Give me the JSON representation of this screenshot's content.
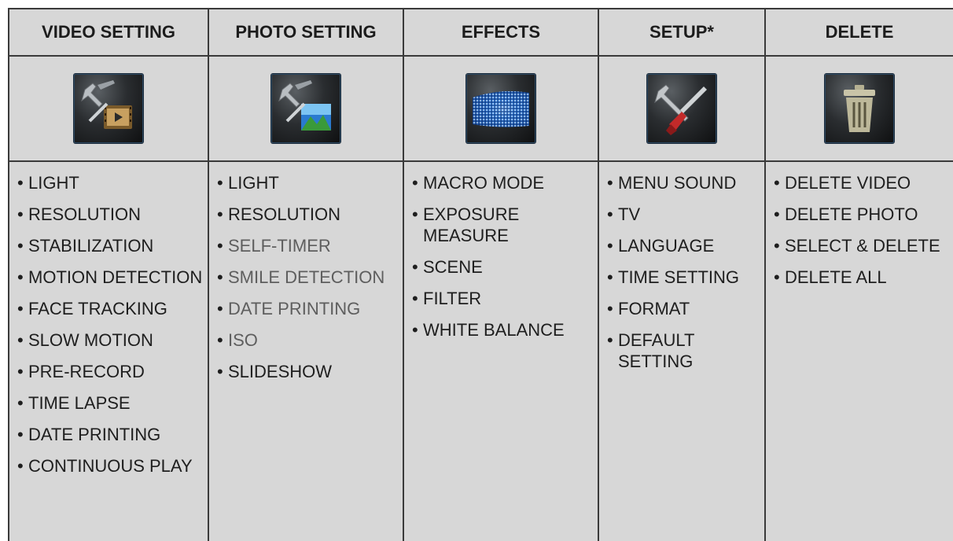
{
  "columns": [
    {
      "title": "VIDEO SETTING",
      "icon": "video-setting-icon",
      "items": [
        {
          "label": "LIGHT",
          "dim": false
        },
        {
          "label": "RESOLUTION",
          "dim": false
        },
        {
          "label": "STABILIZATION",
          "dim": false
        },
        {
          "label": "MOTION DETECTION",
          "dim": false
        },
        {
          "label": "FACE TRACKING",
          "dim": false
        },
        {
          "label": "SLOW MOTION",
          "dim": false
        },
        {
          "label": "PRE-RECORD",
          "dim": false
        },
        {
          "label": "TIME LAPSE",
          "dim": false
        },
        {
          "label": "DATE PRINTING",
          "dim": false
        },
        {
          "label": "CONTINUOUS PLAY",
          "dim": false
        }
      ]
    },
    {
      "title": "PHOTO SETTING",
      "icon": "photo-setting-icon",
      "items": [
        {
          "label": "LIGHT",
          "dim": false
        },
        {
          "label": "RESOLUTION",
          "dim": false
        },
        {
          "label": "SELF-TIMER",
          "dim": true
        },
        {
          "label": "SMILE DETECTION",
          "dim": true
        },
        {
          "label": "DATE PRINTING",
          "dim": true
        },
        {
          "label": "ISO",
          "dim": true
        },
        {
          "label": "SLIDESHOW",
          "dim": false
        }
      ]
    },
    {
      "title": "EFFECTS",
      "icon": "effects-icon",
      "items": [
        {
          "label": "MACRO MODE",
          "dim": false
        },
        {
          "label": "EXPOSURE MEASURE",
          "dim": false
        },
        {
          "label": "SCENE",
          "dim": false
        },
        {
          "label": "FILTER",
          "dim": false
        },
        {
          "label": "WHITE BALANCE",
          "dim": false
        }
      ]
    },
    {
      "title": "SETUP*",
      "icon": "setup-tools-icon",
      "items": [
        {
          "label": "MENU SOUND",
          "dim": false
        },
        {
          "label": "TV",
          "dim": false
        },
        {
          "label": "LANGUAGE",
          "dim": false
        },
        {
          "label": "TIME SETTING",
          "dim": false
        },
        {
          "label": "FORMAT",
          "dim": false
        },
        {
          "label": "DEFAULT SETTING",
          "dim": false
        }
      ]
    },
    {
      "title": "DELETE",
      "icon": "trash-icon",
      "items": [
        {
          "label": "DELETE VIDEO",
          "dim": false
        },
        {
          "label": "DELETE PHOTO",
          "dim": false
        },
        {
          "label": "SELECT & DELETE",
          "dim": false
        },
        {
          "label": "DELETE ALL",
          "dim": false
        }
      ]
    }
  ],
  "colors": {
    "cell_background": "#d7d7d7",
    "border": "#3a3a3a",
    "text": "#1e1e1e",
    "dim_text": "#5e5e5e"
  }
}
